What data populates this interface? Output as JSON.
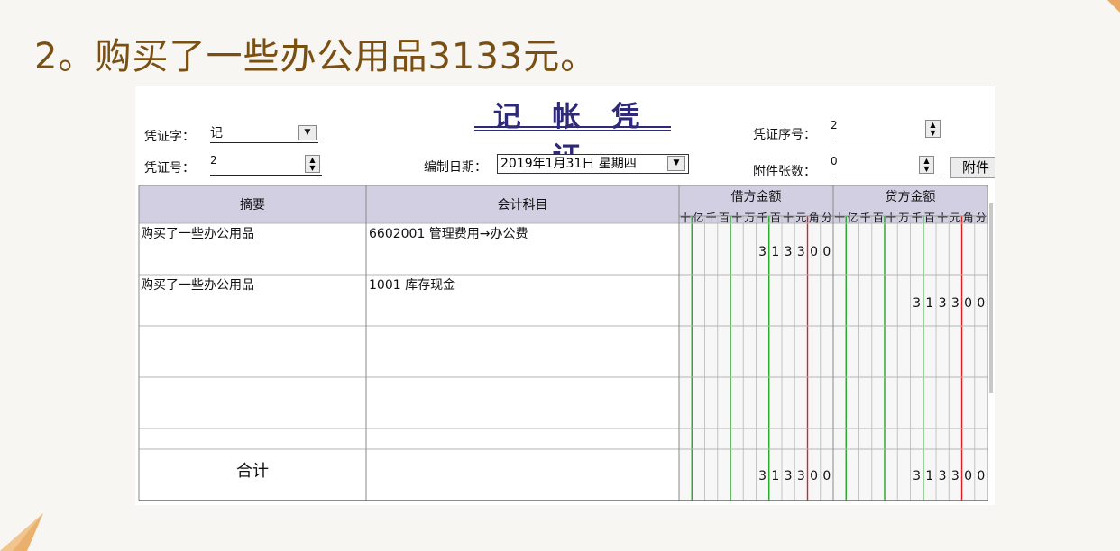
{
  "headline": "2。购买了一些办公用品3133元。",
  "voucher": {
    "title": "记 帐 凭 证",
    "type_label": "凭证字：",
    "type_value": "记",
    "number_label": "凭证号：",
    "number_value": "2",
    "date_label": "编制日期：",
    "date_value": "2019年1月31日 星期四",
    "seq_label": "凭证序号：",
    "seq_value": "2",
    "attach_label": "附件张数：",
    "attach_value": "0",
    "attach_button": "附件"
  },
  "table": {
    "headers": {
      "summary": "摘要",
      "account": "会计科目",
      "debit": "借方金额",
      "credit": "贷方金额"
    },
    "digit_units": [
      "十",
      "亿",
      "千",
      "百",
      "十",
      "万",
      "千",
      "百",
      "十",
      "元",
      "角",
      "分"
    ],
    "rows": [
      {
        "summary": "购买了一些办公用品",
        "account": "6602001 管理费用→办公费",
        "debit": "313300",
        "credit": ""
      },
      {
        "summary": "购买了一些办公用品",
        "account": "1001 库存现金",
        "debit": "",
        "credit": "313300"
      },
      {
        "summary": "",
        "account": "",
        "debit": "",
        "credit": ""
      },
      {
        "summary": "",
        "account": "",
        "debit": "",
        "credit": ""
      },
      {
        "summary": "",
        "account": "",
        "debit": "",
        "credit": ""
      }
    ],
    "total_label": "合计",
    "total_debit": "313300",
    "total_credit": "313300"
  },
  "colors": {
    "header_bg": "#d3cfe3",
    "debit_line": "#22a622",
    "decimal_line": "#e02020",
    "headline": "#7a4f12"
  }
}
